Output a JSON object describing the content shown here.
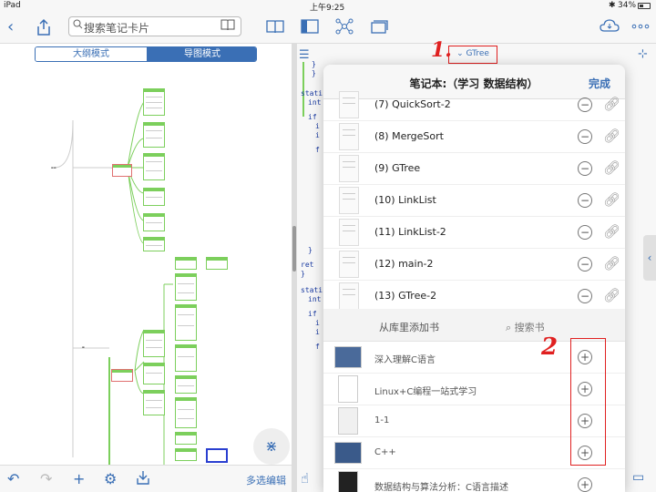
{
  "status_bar": {
    "device": "iPad",
    "time": "上午9:25",
    "bluetooth": "✱",
    "battery": "34%"
  },
  "toolbar": {
    "back_icon": "chevron-left-icon",
    "share_icon": "share-icon",
    "search_placeholder": "搜索笔记卡片",
    "book_icon": "book-icon",
    "right_icons": [
      "open-book-icon",
      "split-view-icon",
      "mindmap-icon",
      "card-stack-icon",
      "cloud-sync-icon",
      "more-icon"
    ]
  },
  "left_pane": {
    "segment": {
      "outline": "大纲模式",
      "mindmap": "导图模式",
      "selected": "导图模式"
    },
    "bottom_bar": {
      "multi_select": "多选编辑"
    }
  },
  "right_pane": {
    "dropdown_label": "GTree",
    "annotation_1": "1.",
    "annotation_2": "2",
    "code_lines": [
      "}",
      "}",
      "stati",
      "int",
      "if",
      "i",
      "i",
      "f",
      "}",
      "ret",
      "}",
      "stati",
      "int",
      "if",
      "i",
      "i",
      "f"
    ]
  },
  "popover": {
    "title": "笔记本:（学习 数据结构）",
    "done": "完成",
    "notes": [
      {
        "label": "(7) QuickSort-2"
      },
      {
        "label": "(8) MergeSort"
      },
      {
        "label": "(9) GTree"
      },
      {
        "label": "(10) LinkList"
      },
      {
        "label": "(11) LinkList-2"
      },
      {
        "label": "(12) main-2"
      },
      {
        "label": "(13) GTree-2"
      }
    ],
    "library": {
      "add_label": "从库里添加书",
      "search_label": "搜索书",
      "books": [
        {
          "label": "深入理解C语言"
        },
        {
          "label": "Linux+C编程一站式学习"
        },
        {
          "label": "1-1"
        },
        {
          "label": "C++"
        },
        {
          "label": "数据结构与算法分析：C语言描述"
        }
      ]
    }
  }
}
